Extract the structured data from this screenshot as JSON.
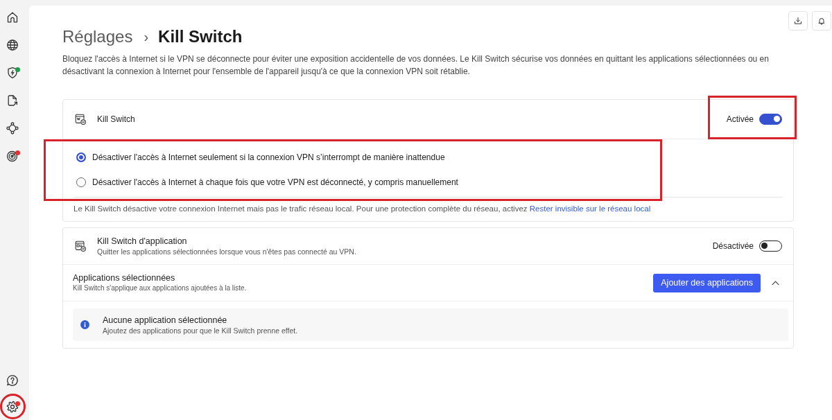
{
  "sidebar": {
    "top_items": [
      {
        "kind": "home",
        "highlighted": false
      },
      {
        "kind": "globe",
        "highlighted": false
      },
      {
        "kind": "shield",
        "color": "#1e9e4a",
        "highlighted": false
      },
      {
        "kind": "file-export",
        "highlighted": false
      },
      {
        "kind": "network",
        "highlighted": false
      },
      {
        "kind": "target",
        "color": "#e5302f",
        "highlighted": false
      }
    ],
    "bottom_items": [
      {
        "kind": "help",
        "highlighted": false
      },
      {
        "kind": "settings",
        "color": "#e5302f",
        "highlighted": true
      }
    ]
  },
  "toolbar": {
    "buttons": [
      {
        "kind": "download"
      },
      {
        "kind": "bell"
      }
    ]
  },
  "breadcrumb": {
    "parent": "Réglages",
    "separator": "›",
    "current": "Kill Switch"
  },
  "description": "Bloquez l'accès à Internet si le VPN se déconnecte pour éviter une exposition accidentelle de vos données. Le Kill Switch sécurise vos données en quittant les applications sélectionnées ou en désactivant la connexion à Internet pour l'ensemble de l'appareil jusqu'à ce que la connexion VPN soit rétablie.",
  "kill_switch": {
    "title": "Kill Switch",
    "state_label": "Activée",
    "on": true,
    "toggle_highlighted": true,
    "options_highlighted": true,
    "options": [
      {
        "label": "Désactiver l'accès à Internet seulement si la connexion VPN s’interrompt de manière inattendue",
        "selected": true
      },
      {
        "label": "Désactiver l'accès à Internet à chaque fois que votre VPN est déconnecté, y compris manuellement",
        "selected": false
      }
    ],
    "note": "Le Kill Switch désactive votre connexion Internet mais pas le trafic réseau local. Pour une protection complète du réseau, activez",
    "note_link": "Rester invisible sur le réseau local"
  },
  "app_kill_switch": {
    "title": "Kill Switch d'application",
    "subtitle": "Quitter les applications sélectionnées lorsque vous n'êtes pas connecté au VPN.",
    "state_label": "Désactivée",
    "on": false,
    "selected_apps": {
      "title": "Applications sélectionnées",
      "subtitle": "Kill Switch s'applique aux applications ajoutées à la liste.",
      "add_button": "Ajouter des applications",
      "expanded": true,
      "empty": {
        "title": "Aucune application sélectionnée",
        "subtitle": "Ajoutez des applications pour que le Kill Switch prenne effet."
      }
    }
  }
}
